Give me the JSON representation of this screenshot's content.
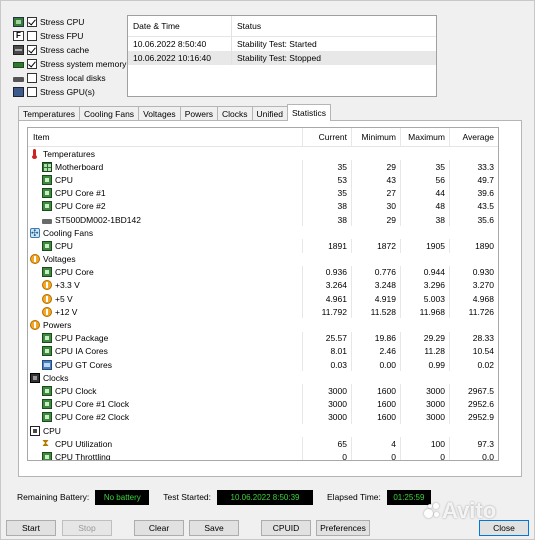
{
  "stress": [
    {
      "label": "Stress CPU",
      "checked": true,
      "icon": "cpu-icon"
    },
    {
      "label": "Stress FPU",
      "checked": false,
      "icon": "fpu-icon"
    },
    {
      "label": "Stress cache",
      "checked": true,
      "icon": "cache-icon"
    },
    {
      "label": "Stress system memory",
      "checked": true,
      "icon": "memory-icon"
    },
    {
      "label": "Stress local disks",
      "checked": false,
      "icon": "disk-icon"
    },
    {
      "label": "Stress GPU(s)",
      "checked": false,
      "icon": "gpu-icon"
    }
  ],
  "log": {
    "col_date": "Date & Time",
    "col_status": "Status",
    "rows": [
      {
        "date": "10.06.2022 8:50:40",
        "status": "Stability Test: Started"
      },
      {
        "date": "10.06.2022 10:16:40",
        "status": "Stability Test: Stopped"
      }
    ]
  },
  "tabs": [
    "Temperatures",
    "Cooling Fans",
    "Voltages",
    "Powers",
    "Clocks",
    "Unified",
    "Statistics"
  ],
  "active_tab": "Statistics",
  "stats": {
    "headers": {
      "item": "Item",
      "current": "Current",
      "minimum": "Minimum",
      "maximum": "Maximum",
      "average": "Average"
    },
    "rows": [
      {
        "type": "group",
        "icon": "ico-temp-grp",
        "name": "thermometer-icon",
        "label": "Temperatures"
      },
      {
        "type": "item",
        "icon": "ico-board",
        "name": "motherboard-icon",
        "label": "Motherboard",
        "cur": "35",
        "min": "29",
        "max": "35",
        "avg": "33.3"
      },
      {
        "type": "item",
        "icon": "ico-chip",
        "name": "chip-icon",
        "label": "CPU",
        "cur": "53",
        "min": "43",
        "max": "56",
        "avg": "49.7"
      },
      {
        "type": "item",
        "icon": "ico-chip",
        "name": "chip-icon",
        "label": "CPU Core #1",
        "cur": "35",
        "min": "27",
        "max": "44",
        "avg": "39.6"
      },
      {
        "type": "item",
        "icon": "ico-chip",
        "name": "chip-icon",
        "label": "CPU Core #2",
        "cur": "38",
        "min": "30",
        "max": "48",
        "avg": "43.5"
      },
      {
        "type": "item",
        "icon": "ico-disk",
        "name": "disk-icon",
        "label": "ST500DM002-1BD142",
        "cur": "38",
        "min": "29",
        "max": "38",
        "avg": "35.6"
      },
      {
        "type": "group",
        "icon": "ico-fan",
        "name": "fan-icon",
        "label": "Cooling Fans"
      },
      {
        "type": "item",
        "icon": "ico-chip",
        "name": "chip-icon",
        "label": "CPU",
        "cur": "1891",
        "min": "1872",
        "max": "1905",
        "avg": "1890"
      },
      {
        "type": "group",
        "icon": "ico-volt-grp",
        "name": "voltage-icon",
        "label": "Voltages"
      },
      {
        "type": "item",
        "icon": "ico-chip",
        "name": "chip-icon",
        "label": "CPU Core",
        "cur": "0.936",
        "min": "0.776",
        "max": "0.944",
        "avg": "0.930"
      },
      {
        "type": "item",
        "icon": "ico-volt",
        "name": "voltage-icon",
        "label": "+3.3 V",
        "cur": "3.264",
        "min": "3.248",
        "max": "3.296",
        "avg": "3.270"
      },
      {
        "type": "item",
        "icon": "ico-volt",
        "name": "voltage-icon",
        "label": "+5 V",
        "cur": "4.961",
        "min": "4.919",
        "max": "5.003",
        "avg": "4.968"
      },
      {
        "type": "item",
        "icon": "ico-volt",
        "name": "voltage-icon",
        "label": "+12 V",
        "cur": "11.792",
        "min": "11.528",
        "max": "11.968",
        "avg": "11.726"
      },
      {
        "type": "group",
        "icon": "ico-power-grp",
        "name": "power-icon",
        "label": "Powers"
      },
      {
        "type": "item",
        "icon": "ico-chip",
        "name": "chip-icon",
        "label": "CPU Package",
        "cur": "25.57",
        "min": "19.86",
        "max": "29.29",
        "avg": "28.33"
      },
      {
        "type": "item",
        "icon": "ico-chip",
        "name": "chip-icon",
        "label": "CPU IA Cores",
        "cur": "8.01",
        "min": "2.46",
        "max": "11.28",
        "avg": "10.54"
      },
      {
        "type": "item",
        "icon": "ico-gpu",
        "name": "gpu-icon",
        "label": "CPU GT Cores",
        "cur": "0.03",
        "min": "0.00",
        "max": "0.99",
        "avg": "0.02"
      },
      {
        "type": "group",
        "icon": "ico-clock-grp",
        "name": "clock-icon",
        "label": "Clocks"
      },
      {
        "type": "item",
        "icon": "ico-chip",
        "name": "chip-icon",
        "label": "CPU Clock",
        "cur": "3000",
        "min": "1600",
        "max": "3000",
        "avg": "2967.5"
      },
      {
        "type": "item",
        "icon": "ico-chip",
        "name": "chip-icon",
        "label": "CPU Core #1 Clock",
        "cur": "3000",
        "min": "1600",
        "max": "3000",
        "avg": "2952.6"
      },
      {
        "type": "item",
        "icon": "ico-chip",
        "name": "chip-icon",
        "label": "CPU Core #2 Clock",
        "cur": "3000",
        "min": "1600",
        "max": "3000",
        "avg": "2952.9"
      },
      {
        "type": "group",
        "icon": "ico-cpu-grp",
        "name": "cpu-icon",
        "label": "CPU"
      },
      {
        "type": "item",
        "icon": "ico-hourglass",
        "name": "hourglass-icon",
        "label": "CPU Utilization",
        "cur": "65",
        "min": "4",
        "max": "100",
        "avg": "97.3"
      },
      {
        "type": "item",
        "icon": "ico-chip",
        "name": "chip-icon",
        "label": "CPU Throttling",
        "cur": "0",
        "min": "0",
        "max": "0",
        "avg": "0.0"
      }
    ]
  },
  "status": {
    "battery_label": "Remaining Battery:",
    "battery_value": "No battery",
    "started_label": "Test Started:",
    "started_value": "10.06.2022 8:50:39",
    "elapsed_label": "Elapsed Time:",
    "elapsed_value": "01:25:59"
  },
  "buttons": {
    "start": "Start",
    "stop": "Stop",
    "clear": "Clear",
    "save": "Save",
    "cpuid": "CPUID",
    "preferences": "Preferences",
    "close": "Close"
  },
  "watermark": "Avito"
}
